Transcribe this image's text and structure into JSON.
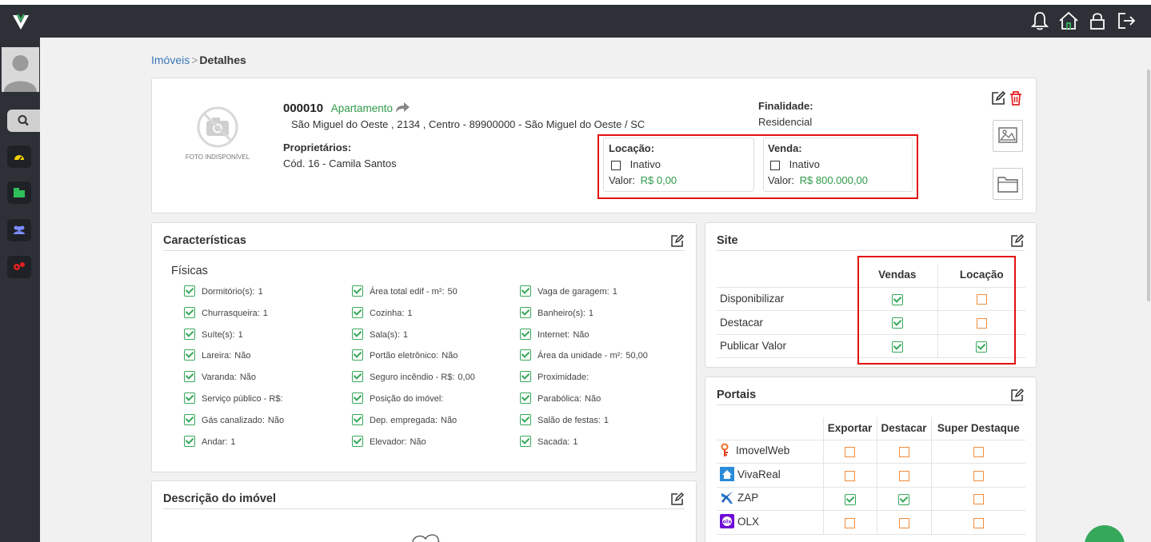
{
  "breadcrumb": {
    "root": "Imóveis",
    "current": "Detalhes"
  },
  "property": {
    "code": "000010",
    "type": "Apartamento",
    "address": "São Miguel do Oeste , 2134 , Centro - 89900000 - São Miguel do Oeste / SC",
    "owners_label": "Proprietários:",
    "owners_value": "Cód. 16 - Camila Santos",
    "photo_label": "FOTO INDISPONÍVEL",
    "finalidade_label": "Finalidade:",
    "finalidade_value": "Residencial",
    "locacao": {
      "label": "Locação:",
      "status": "Inativo",
      "valor_label": "Valor:",
      "valor": "R$ 0,00"
    },
    "venda": {
      "label": "Venda:",
      "status": "Inativo",
      "valor_label": "Valor:",
      "valor": "R$ 800.000,00"
    }
  },
  "caracteristicas": {
    "title": "Características",
    "subtitle": "Físicas",
    "items": [
      {
        "label": "Dormitório(s):",
        "value": "1"
      },
      {
        "label": "Área total edif - m²:",
        "value": "50"
      },
      {
        "label": "Vaga de garagem:",
        "value": "1"
      },
      {
        "label": "Churrasqueira:",
        "value": "1"
      },
      {
        "label": "Cozinha:",
        "value": "1"
      },
      {
        "label": "Banheiro(s):",
        "value": "1"
      },
      {
        "label": "Suíte(s):",
        "value": "1"
      },
      {
        "label": "Sala(s):",
        "value": "1"
      },
      {
        "label": "Internet:",
        "value": "Não"
      },
      {
        "label": "Lareira:",
        "value": "Não"
      },
      {
        "label": "Portão eletrônico:",
        "value": "Não"
      },
      {
        "label": "Área da unidade - m²:",
        "value": "50,00"
      },
      {
        "label": "Varanda:",
        "value": "Não"
      },
      {
        "label": "Seguro incêndio - R$:",
        "value": "0,00"
      },
      {
        "label": "Proximidade:",
        "value": ""
      },
      {
        "label": "Serviço público - R$:",
        "value": ""
      },
      {
        "label": "Posição do imóvel:",
        "value": ""
      },
      {
        "label": "Parabólica:",
        "value": "Não"
      },
      {
        "label": "Gás canalizado:",
        "value": "Não"
      },
      {
        "label": "Dep. empregada:",
        "value": "Não"
      },
      {
        "label": "Salão de festas:",
        "value": "1"
      },
      {
        "label": "Andar:",
        "value": "1"
      },
      {
        "label": "Elevador:",
        "value": "Não"
      },
      {
        "label": "Sacada:",
        "value": "1"
      }
    ]
  },
  "descricao": {
    "title": "Descrição do imóvel"
  },
  "site": {
    "title": "Site",
    "col_vendas": "Vendas",
    "col_locacao": "Locação",
    "rows": [
      {
        "label": "Disponibilizar",
        "vendas": true,
        "locacao": false
      },
      {
        "label": "Destacar",
        "vendas": true,
        "locacao": false
      },
      {
        "label": "Publicar Valor",
        "vendas": true,
        "locacao": true
      }
    ]
  },
  "portais": {
    "title": "Portais",
    "col_exportar": "Exportar",
    "col_destacar": "Destacar",
    "col_super": "Super Destaque",
    "rows": [
      {
        "name": "ImovelWeb",
        "icon": "imovelweb-icon",
        "exportar": false,
        "destacar": false,
        "super": false
      },
      {
        "name": "VivaReal",
        "icon": "vivareal-icon",
        "exportar": false,
        "destacar": false,
        "super": false
      },
      {
        "name": "ZAP",
        "icon": "zap-icon",
        "exportar": true,
        "destacar": true,
        "super": false
      },
      {
        "name": "OLX",
        "icon": "olx-icon",
        "exportar": false,
        "destacar": false,
        "super": false
      }
    ]
  },
  "colors": {
    "topbar": "#2d3036",
    "accent_green": "#36a85a",
    "link_blue": "#3d78b8",
    "highlight_red": "#e31111",
    "checkbox_orange": "#f08d3c"
  }
}
